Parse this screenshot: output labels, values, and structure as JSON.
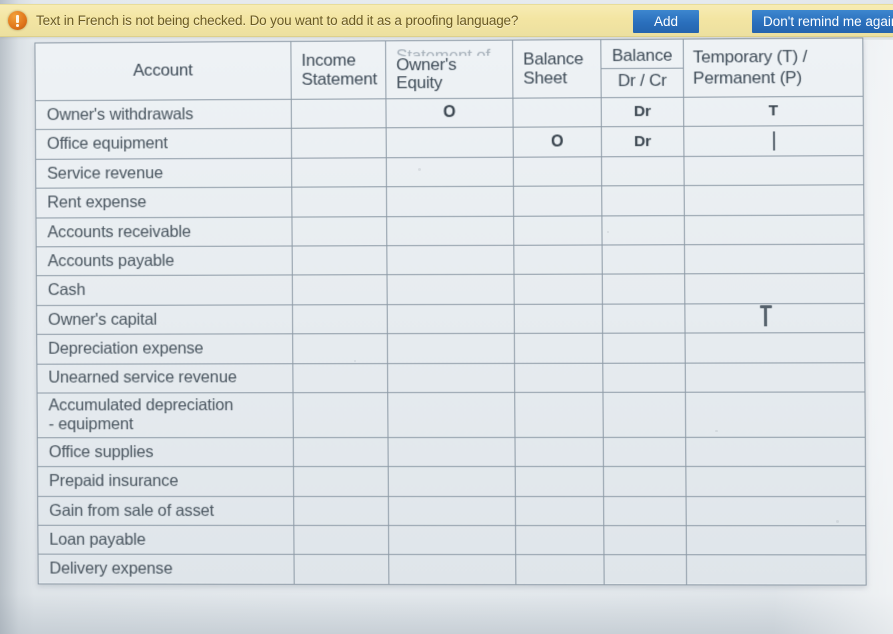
{
  "notification": {
    "icon": "warning-exclamation-icon",
    "message": "Text in French is not being checked. Do you want to add it as a proofing language?",
    "add_label": "Add",
    "dismiss_label": "Don't remind me again",
    "bar_color": "#f3e5a2",
    "button_color": "#2a6fbc"
  },
  "worksheet": {
    "columns": [
      {
        "key": "account",
        "label": "Account",
        "clipped_top": ""
      },
      {
        "key": "income_statement",
        "line1": "Income",
        "line2": "Statement"
      },
      {
        "key": "statement_owners_equity",
        "clipped_top": "Statement of",
        "line1": "Owner's",
        "line2": "Equity"
      },
      {
        "key": "balance_sheet",
        "line1": "Balance",
        "line2": "Sheet"
      },
      {
        "key": "balance_dr_cr",
        "line1": "Balance",
        "line2": "Dr / Cr"
      },
      {
        "key": "temporary_permanent",
        "line1": "Temporary (T) /",
        "line2": "Permanent  (P)"
      }
    ],
    "rows": [
      {
        "account": "Owner's withdrawals",
        "income_statement": "",
        "owners_equity": "O",
        "balance_sheet": "",
        "dr_cr": "Dr",
        "temp_perm": "T"
      },
      {
        "account": "Office equipment",
        "income_statement": "",
        "owners_equity": "",
        "balance_sheet": "O",
        "dr_cr": "Dr",
        "temp_perm": "",
        "temp_perm_caret": true
      },
      {
        "account": "Service revenue",
        "income_statement": "",
        "owners_equity": "",
        "balance_sheet": "",
        "dr_cr": "",
        "temp_perm": ""
      },
      {
        "account": "Rent expense",
        "income_statement": "",
        "owners_equity": "",
        "balance_sheet": "",
        "dr_cr": "",
        "temp_perm": ""
      },
      {
        "account": "Accounts receivable",
        "income_statement": "",
        "owners_equity": "",
        "balance_sheet": "",
        "dr_cr": "",
        "temp_perm": ""
      },
      {
        "account": "Accounts payable",
        "income_statement": "",
        "owners_equity": "",
        "balance_sheet": "",
        "dr_cr": "",
        "temp_perm": ""
      },
      {
        "account": "Cash",
        "income_statement": "",
        "owners_equity": "",
        "balance_sheet": "",
        "dr_cr": "",
        "temp_perm": ""
      },
      {
        "account": "Owner's capital",
        "income_statement": "",
        "owners_equity": "",
        "balance_sheet": "",
        "dr_cr": "",
        "temp_perm": ""
      },
      {
        "account": "Depreciation expense",
        "income_statement": "",
        "owners_equity": "",
        "balance_sheet": "",
        "dr_cr": "",
        "temp_perm": ""
      },
      {
        "account": "Unearned service revenue",
        "income_statement": "",
        "owners_equity": "",
        "balance_sheet": "",
        "dr_cr": "",
        "temp_perm": ""
      },
      {
        "account": "Accumulated depreciation\n- equipment",
        "income_statement": "",
        "owners_equity": "",
        "balance_sheet": "",
        "dr_cr": "",
        "temp_perm": "",
        "tall": true
      },
      {
        "account": "Office supplies",
        "income_statement": "",
        "owners_equity": "",
        "balance_sheet": "",
        "dr_cr": "",
        "temp_perm": ""
      },
      {
        "account": "Prepaid insurance",
        "income_statement": "",
        "owners_equity": "",
        "balance_sheet": "",
        "dr_cr": "",
        "temp_perm": ""
      },
      {
        "account": "Gain from sale of asset",
        "income_statement": "",
        "owners_equity": "",
        "balance_sheet": "",
        "dr_cr": "",
        "temp_perm": ""
      },
      {
        "account": "Loan payable",
        "income_statement": "",
        "owners_equity": "",
        "balance_sheet": "",
        "dr_cr": "",
        "temp_perm": ""
      },
      {
        "account": "Delivery expense",
        "income_statement": "",
        "owners_equity": "",
        "balance_sheet": "",
        "dr_cr": "",
        "temp_perm": ""
      }
    ]
  },
  "cursor": {
    "type": "ibeam-text-cursor",
    "over_row_account": "Accounts payable",
    "over_column": "temporary_permanent"
  }
}
